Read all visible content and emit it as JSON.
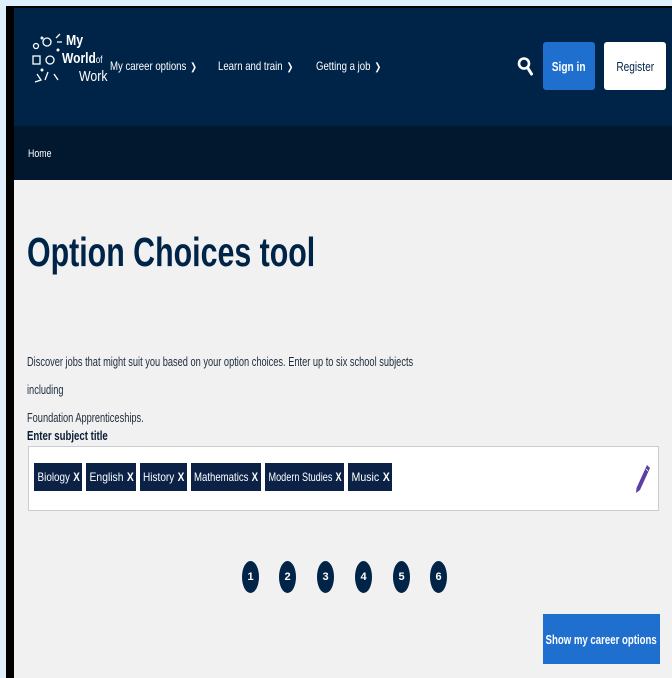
{
  "header": {
    "logo": {
      "line1": "My",
      "line2": "World",
      "line2_small": "of",
      "line3": "Work"
    },
    "nav": [
      {
        "label": "My career options"
      },
      {
        "label": "Learn and train"
      },
      {
        "label": "Getting a job"
      }
    ],
    "sign_in": "Sign in",
    "register": "Register",
    "search_icon": "search-icon"
  },
  "breadcrumb": {
    "home": "Home"
  },
  "main": {
    "title": "Option Choices tool",
    "intro_line1": "Discover jobs that might suit you based on your option choices. Enter up to six school subjects including",
    "intro_line2": "Foundation Apprenticeships.",
    "field_label": "Enter subject title",
    "tags": [
      {
        "label": "Biology",
        "remove": "X"
      },
      {
        "label": "English",
        "remove": "X"
      },
      {
        "label": "History",
        "remove": "X"
      },
      {
        "label": "Mathematics",
        "remove": "X"
      },
      {
        "label": "Modern Studies",
        "remove": "X"
      },
      {
        "label": "Music",
        "remove": "X"
      }
    ],
    "steps": [
      "1",
      "2",
      "3",
      "4",
      "5",
      "6"
    ],
    "cta": "Show my career options"
  },
  "colors": {
    "header_bg": "#002447",
    "breadcrumb_bg": "#01182f",
    "primary_button": "#1f6fcf",
    "tag_bg": "#0b2246",
    "edit_icon": "#5b3fa6",
    "page_bg": "#f1f1f1"
  }
}
